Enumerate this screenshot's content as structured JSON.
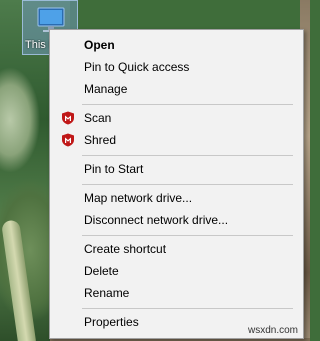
{
  "desktop_icon": {
    "label": "This PC"
  },
  "context_menu": {
    "items": [
      {
        "label": "Open",
        "bold": true
      },
      {
        "label": "Pin to Quick access"
      },
      {
        "label": "Manage"
      },
      {
        "label": "Scan",
        "icon": "mcafee-shield-icon"
      },
      {
        "label": "Shred",
        "icon": "mcafee-shield-icon"
      },
      {
        "label": "Pin to Start"
      },
      {
        "label": "Map network drive..."
      },
      {
        "label": "Disconnect network drive..."
      },
      {
        "label": "Create shortcut"
      },
      {
        "label": "Delete"
      },
      {
        "label": "Rename"
      },
      {
        "label": "Properties"
      }
    ]
  },
  "colors": {
    "mcafee_red": "#c01818",
    "menu_bg": "#f2f2f2"
  },
  "watermark": "wsxdn.com"
}
